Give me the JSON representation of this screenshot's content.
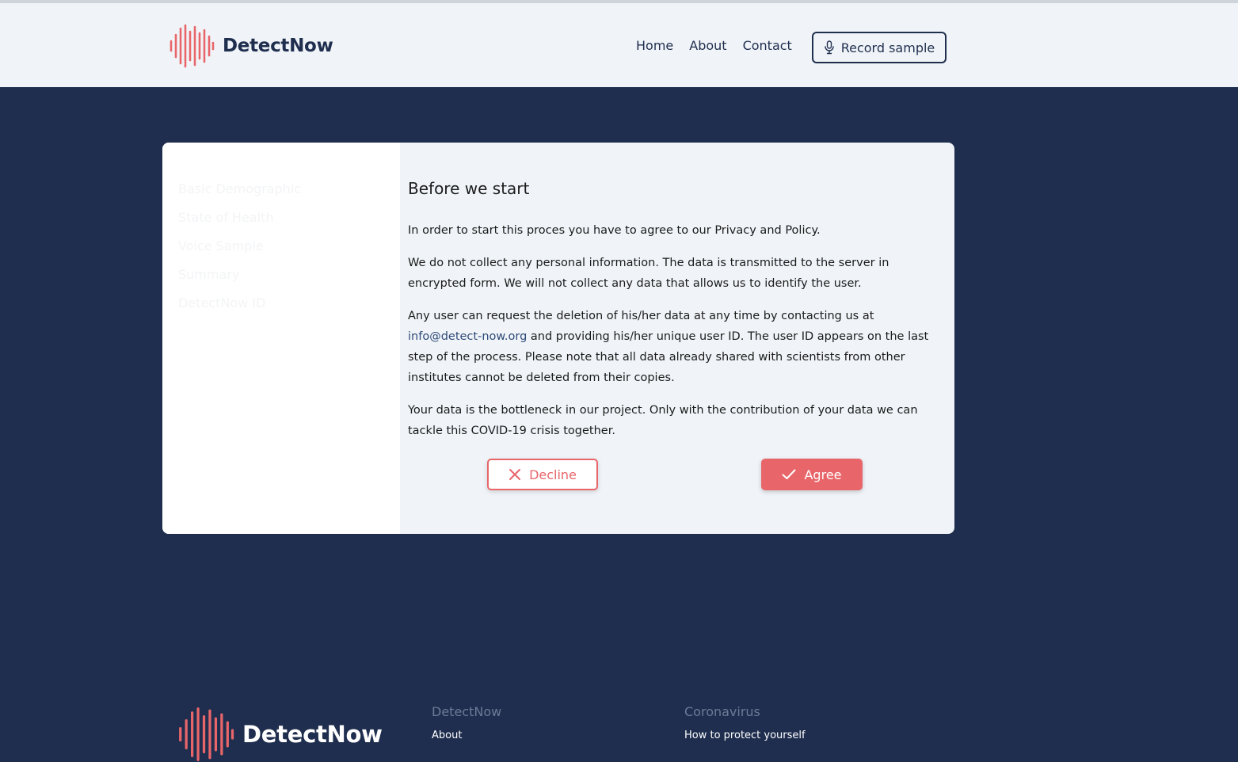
{
  "header": {
    "brand": "DetectNow",
    "nav": [
      {
        "label": "Home"
      },
      {
        "label": "About"
      },
      {
        "label": "Contact"
      }
    ],
    "record_button": "Record sample"
  },
  "sidebar": {
    "steps": [
      {
        "label": "Basic Demographic"
      },
      {
        "label": "State of Health"
      },
      {
        "label": "Voice Sample"
      },
      {
        "label": "Summary"
      },
      {
        "label": "DetectNow ID"
      }
    ]
  },
  "main": {
    "title": "Before we start",
    "paragraph1": "In order to start this proces you have to agree to our Privacy and Policy.",
    "paragraph2": "We do not collect any personal information. The data is transmitted to the server in encrypted form. We will not collect any data that allows us to identify the user.",
    "paragraph3_start": "Any user can request the deletion of his/her data at any time by contacting us at",
    "email": "info@detect-now.org",
    "paragraph3_end": "and providing his/her unique user ID. The user ID appears on the last step of the process. Please note that all data already shared with scientists from other institutes cannot be deleted from their copies.",
    "paragraph4": "Your data is the bottleneck in our project. Only with the contribution of your data we can tackle this COVID-19 crisis together.",
    "decline_label": "Decline",
    "agree_label": "Agree"
  },
  "footer": {
    "brand": "DetectNow",
    "columns": [
      {
        "heading": "DetectNow",
        "links": [
          "About"
        ]
      },
      {
        "heading": "Coronavirus",
        "links": [
          "How to protect yourself"
        ]
      }
    ]
  },
  "colors": {
    "navy": "#1f2e4e",
    "accent": "#e8666a",
    "light_bg": "#f0f4f8"
  },
  "icons": [
    "soundwave-logo-icon",
    "microphone-icon",
    "close-icon",
    "check-icon"
  ]
}
